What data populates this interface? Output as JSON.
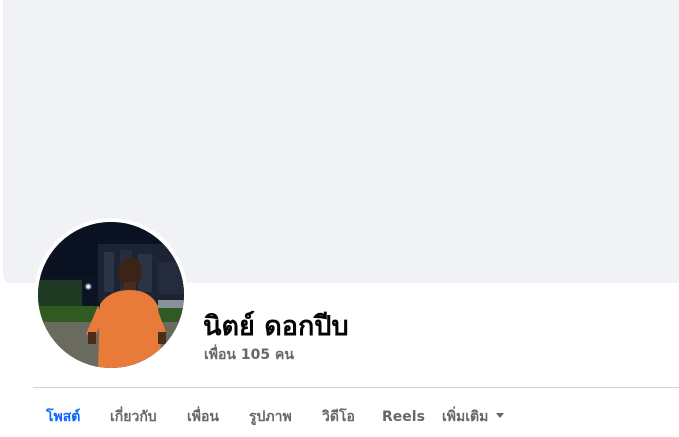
{
  "profile": {
    "name": "นิตย์ ดอกปีบ",
    "friends_text": "เพื่อน 105 คน"
  },
  "tabs": [
    {
      "label": "โพสต์",
      "active": true
    },
    {
      "label": "เกี่ยวกับ",
      "active": false
    },
    {
      "label": "เพื่อน",
      "active": false
    },
    {
      "label": "รูปภาพ",
      "active": false
    },
    {
      "label": "วิดีโอ",
      "active": false
    },
    {
      "label": "Reels",
      "active": false
    },
    {
      "label": "เพิ่มเติม",
      "active": false
    }
  ],
  "icons": {
    "more_tab": "caret-down-icon"
  },
  "colors": {
    "accent": "#0866ff",
    "cover_bg": "#f0f2f5",
    "secondary_text": "#65676b",
    "primary_text": "#050505",
    "divider": "#ced0d4"
  }
}
